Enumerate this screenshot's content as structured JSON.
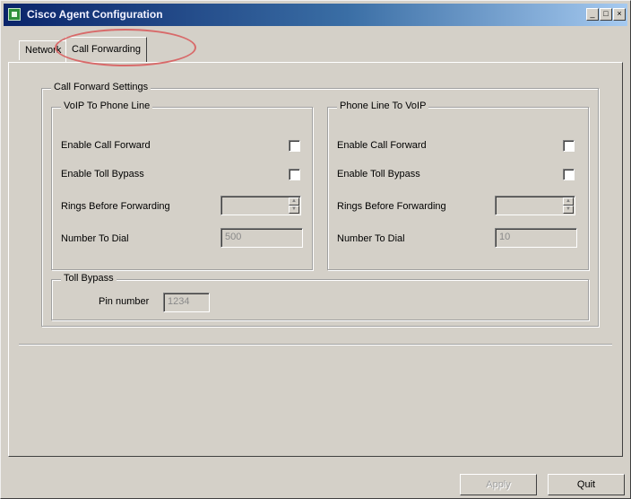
{
  "window": {
    "title": "Cisco Agent Configuration",
    "controls": {
      "minimize": "_",
      "maximize": "□",
      "close": "×"
    }
  },
  "tabs": [
    {
      "label": "Network",
      "active": false
    },
    {
      "label": "Call Forwarding",
      "active": true
    }
  ],
  "highlight_color": "#d86a6a",
  "call_forward_settings": {
    "title": "Call Forward Settings",
    "voip_to_phone": {
      "title": "VoIP To Phone Line",
      "enable_call_forward": "Enable Call Forward",
      "enable_toll_bypass": "Enable Toll Bypass",
      "rings_before_forwarding": "Rings Before Forwarding",
      "rings_value": "",
      "number_to_dial": "Number To Dial",
      "number_value": "500"
    },
    "phone_to_voip": {
      "title": "Phone Line To VoIP",
      "enable_call_forward": "Enable Call Forward",
      "enable_toll_bypass": "Enable Toll Bypass",
      "rings_before_forwarding": "Rings Before Forwarding",
      "rings_value": "",
      "number_to_dial": "Number To Dial",
      "number_value": "10"
    },
    "toll_bypass": {
      "title": "Toll Bypass",
      "pin_number_label": "Pin number",
      "pin_number_value": "1234"
    }
  },
  "footer": {
    "apply_label": "Apply",
    "quit_label": "Quit"
  }
}
